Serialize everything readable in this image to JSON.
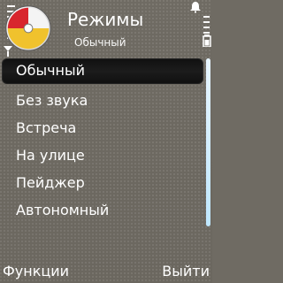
{
  "header": {
    "title": "Режимы",
    "subtitle": "Обычный"
  },
  "list": {
    "items": [
      {
        "label": "Обычный",
        "selected": true
      },
      {
        "label": "Без звука",
        "selected": false
      },
      {
        "label": "Встреча",
        "selected": false
      },
      {
        "label": "На улице",
        "selected": false
      },
      {
        "label": "Пейджер",
        "selected": false
      },
      {
        "label": "Автономный",
        "selected": false
      }
    ]
  },
  "softkeys": {
    "left": "Функции",
    "right": "Выйти"
  },
  "status": {
    "signal_icon": "signal-icon",
    "battery_icon": "battery-icon",
    "alert_icon": "bell-icon"
  },
  "colors": {
    "background": "#6f6b63",
    "selected_bg": "#151515",
    "scroll_thumb": "#cfeeff",
    "text": "#ffffff",
    "icon_red": "#d8262e",
    "icon_yellow": "#f0c22d"
  }
}
